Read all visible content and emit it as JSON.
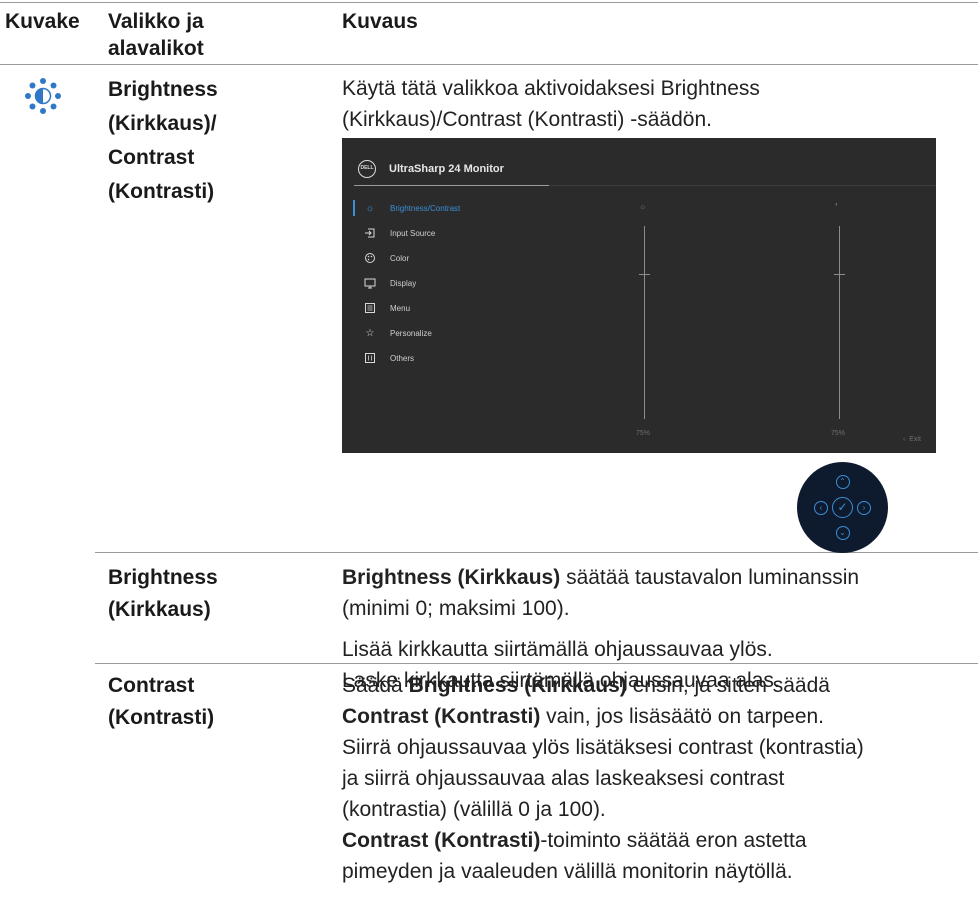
{
  "headers": {
    "icon": "Kuvake",
    "menu_line1": "Valikko ja",
    "menu_line2": "alavalikot",
    "desc": "Kuvaus"
  },
  "row1": {
    "icon": "brightness-icon",
    "menu_lines": [
      "Brightness",
      "(Kirkkaus)/",
      "Contrast",
      "(Kontrasti)"
    ],
    "desc_lines": [
      "Käytä tätä valikkoa aktivoidaksesi Brightness",
      "(Kirkkaus)/Contrast (Kontrasti) -säädön."
    ]
  },
  "osd": {
    "logo_text": "DELL",
    "title": "UltraSharp 24 Monitor",
    "menu_items": [
      {
        "label": "Brightness/Contrast",
        "icon": "sun-icon"
      },
      {
        "label": "Input Source",
        "icon": "input-icon"
      },
      {
        "label": "Color",
        "icon": "palette-icon"
      },
      {
        "label": "Display",
        "icon": "monitor-icon"
      },
      {
        "label": "Menu",
        "icon": "menu-icon"
      },
      {
        "label": "Personalize",
        "icon": "star-icon"
      },
      {
        "label": "Others",
        "icon": "others-icon"
      }
    ],
    "brightness_value": "75%",
    "contrast_value": "75%",
    "exit_label": "Exit",
    "brightness_level": 0.75,
    "contrast_level": 0.75
  },
  "joystick": {
    "icons": [
      "up-arrow-icon",
      "left-arrow-icon",
      "check-icon",
      "right-arrow-icon",
      "down-arrow-icon"
    ]
  },
  "row2": {
    "menu_lines": [
      "Brightness",
      "(Kirkkaus)"
    ],
    "p1_bold": "Brightness (Kirkkaus)",
    "p1_rest": " säätää taustavalon luminanssin",
    "p1_line2": "(minimi 0; maksimi 100).",
    "p2_line1": "Lisää kirkkautta siirtämällä ohjaussauvaa ylös.",
    "p2_line2": "Laske kirkkautta siirtämällä ohjaussauvaa alas."
  },
  "row3": {
    "menu_lines": [
      "Contrast",
      "(Kontrasti)"
    ],
    "l1_pre": "Säädä ",
    "l1_bold": "Brightness (Kirkkaus)",
    "l1_post": " ensin, ja sitten säädä",
    "l2_bold": "Contrast (Kontrasti)",
    "l2_post": " vain, jos lisäsäätö on tarpeen.",
    "l3": "Siirrä ohjaussauvaa ylös lisätäksesi contrast (kontrastia)",
    "l4": "ja siirrä ohjaussauvaa alas laskeaksesi contrast",
    "l5": "(kontrastia) (välillä 0 ja 100).",
    "l6_bold": "Contrast (Kontrasti)",
    "l6_post": "-toiminto säätää eron astetta",
    "l7": "pimeyden ja vaaleuden välillä monitorin näytöllä."
  }
}
